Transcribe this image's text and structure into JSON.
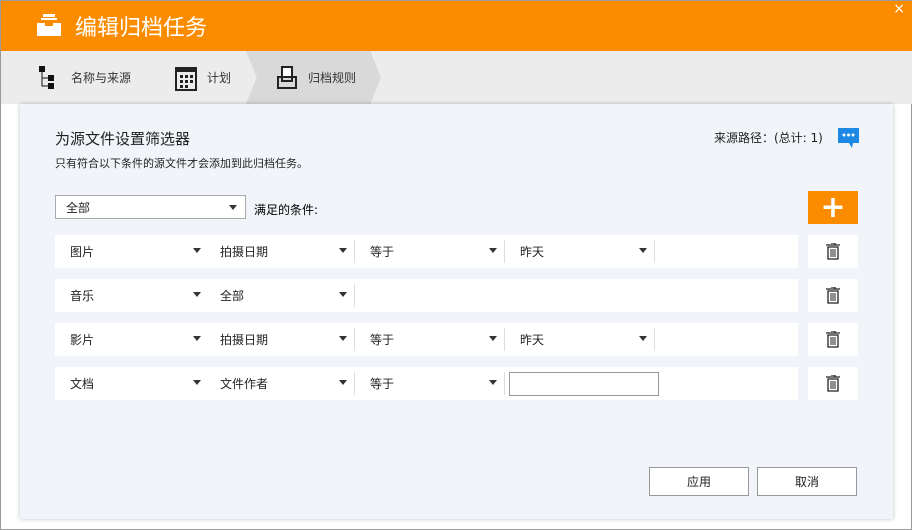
{
  "window": {
    "title": "编辑归档任务",
    "close": "×"
  },
  "tabs": [
    {
      "label": "名称与来源"
    },
    {
      "label": "计划"
    },
    {
      "label": "归档规则"
    }
  ],
  "panel": {
    "heading": "为源文件设置筛选器",
    "subtitle": "只有符合以下条件的源文件才会添加到此归档任务。",
    "source_path": "来源路径：(总计: 1)",
    "match_select": "全部",
    "match_label": "满足的条件:",
    "add_label": "+"
  },
  "rules": [
    {
      "type": "图片",
      "field": "拍摄日期",
      "op": "等于",
      "value": "昨天",
      "value_kind": "select"
    },
    {
      "type": "音乐",
      "field": "全部"
    },
    {
      "type": "影片",
      "field": "拍摄日期",
      "op": "等于",
      "value": "昨天",
      "value_kind": "select"
    },
    {
      "type": "文档",
      "field": "文件作者",
      "op": "等于",
      "value": "",
      "value_kind": "input"
    }
  ],
  "buttons": {
    "apply": "应用",
    "cancel": "取消"
  },
  "colors": {
    "accent": "#fb8c00",
    "info": "#1e88e5"
  }
}
